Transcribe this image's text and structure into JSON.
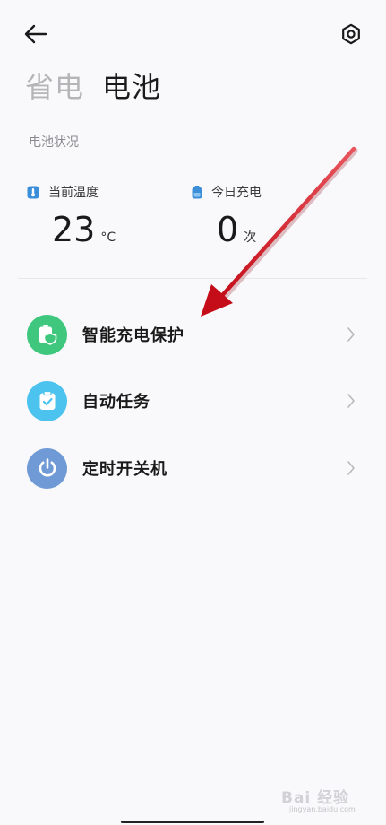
{
  "tabs": [
    {
      "label": "省电",
      "active": false
    },
    {
      "label": "电池",
      "active": true
    }
  ],
  "battery_status": {
    "section_label": "电池状况",
    "temperature": {
      "label": "当前温度",
      "value": "23",
      "unit": "°C",
      "icon": "thermometer-icon"
    },
    "charges_today": {
      "label": "今日充电",
      "value": "0",
      "unit": "次",
      "icon": "battery-icon"
    }
  },
  "menu": [
    {
      "label": "智能充电保护",
      "icon": "battery-shield-icon",
      "color": "#3fc87d"
    },
    {
      "label": "自动任务",
      "icon": "clipboard-check-icon",
      "color": "#4cc3ee"
    },
    {
      "label": "定时开关机",
      "icon": "power-icon",
      "color": "#6f9ad6"
    }
  ],
  "accent_colors": {
    "temperature_icon": "#3a8fd8",
    "annotation_arrow": "#d0111b"
  },
  "watermark": {
    "main": "Bai 经验",
    "sub": "jingyan.baidu.com"
  }
}
